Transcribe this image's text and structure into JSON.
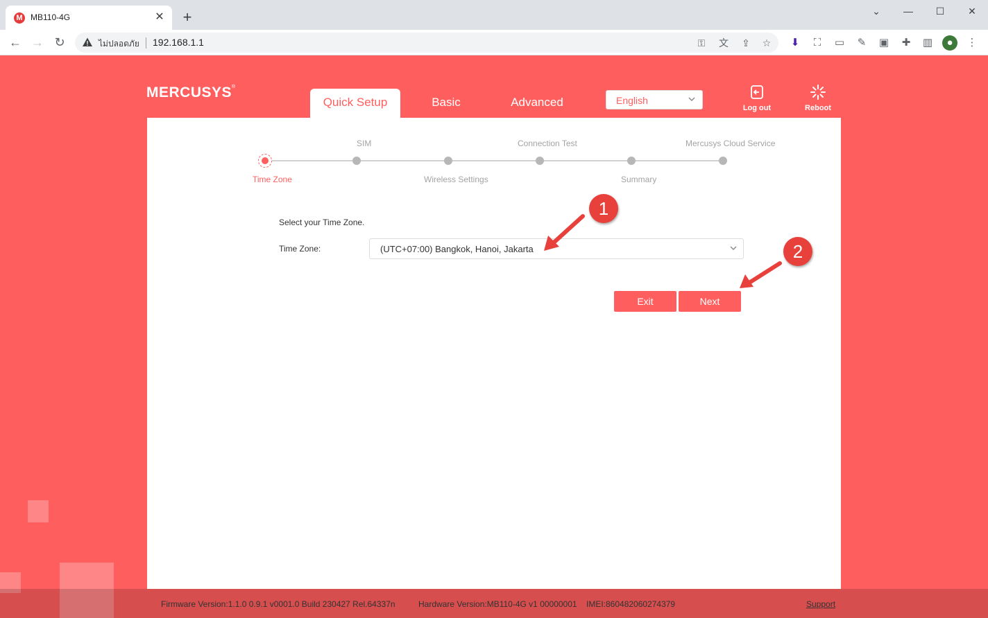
{
  "browser": {
    "tab_title": "MB110-4G",
    "favicon_letter": "M",
    "security_text": "ไม่ปลอดภัย",
    "url": "192.168.1.1"
  },
  "header": {
    "brand": "MERCUSYS",
    "nav_tabs": [
      {
        "label": "Quick Setup",
        "active": true
      },
      {
        "label": "Basic",
        "active": false
      },
      {
        "label": "Advanced",
        "active": false
      }
    ],
    "language": "English",
    "logout_label": "Log out",
    "reboot_label": "Reboot"
  },
  "stepper": {
    "top_labels": [
      "SIM",
      "Connection Test",
      "Mercusys Cloud Service"
    ],
    "bottom_labels": [
      "Time Zone",
      "Wireless Settings",
      "Summary"
    ],
    "current_step": "Time Zone"
  },
  "form": {
    "intro": "Select your Time Zone.",
    "timezone_label": "Time Zone:",
    "timezone_value": "(UTC+07:00) Bangkok, Hanoi, Jakarta"
  },
  "buttons": {
    "exit": "Exit",
    "next": "Next"
  },
  "annotations": [
    "1",
    "2"
  ],
  "footer": {
    "firmware": "Firmware Version:1.1.0 0.9.1 v0001.0 Build 230427 Rel.64337n",
    "hardware": "Hardware Version:MB110-4G v1 00000001",
    "imei": "IMEI:860482060274379",
    "support": "Support"
  },
  "colors": {
    "brand": "#ff5e5e",
    "callout": "#e8403a"
  }
}
